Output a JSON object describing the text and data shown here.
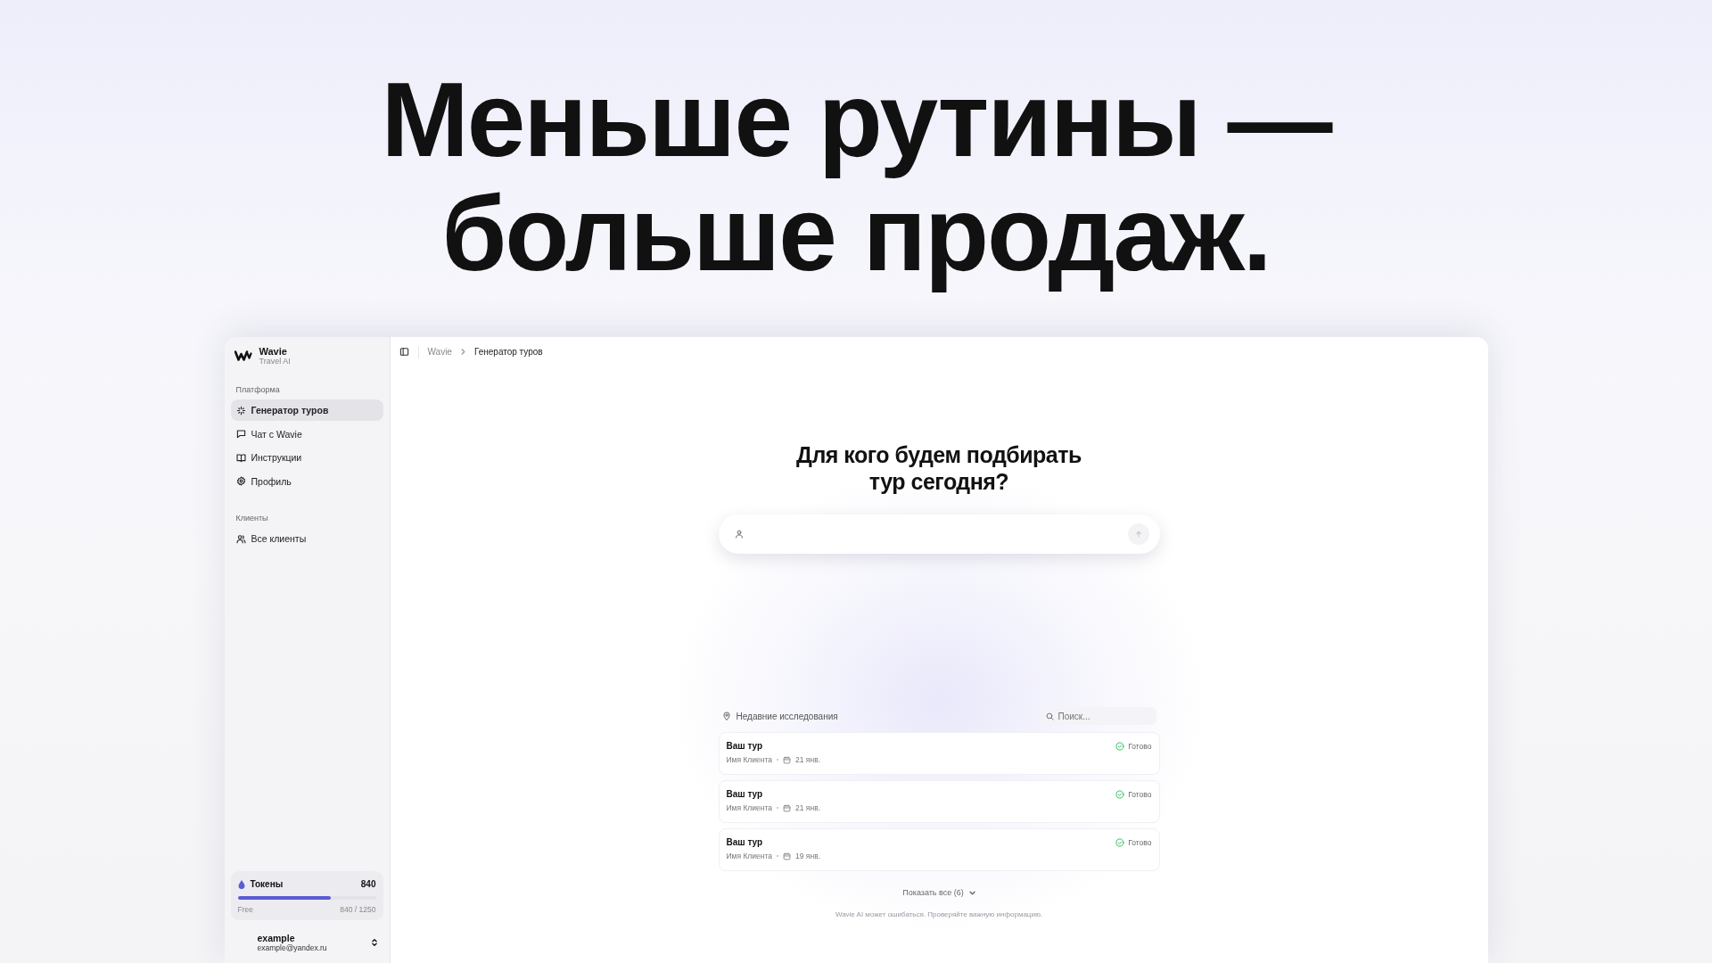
{
  "headline": {
    "lines": [
      "Меньше рутины —",
      "больше продаж."
    ]
  },
  "sidebar": {
    "brand": {
      "name": "Wavie",
      "subtitle": "Travel AI"
    },
    "groups": [
      {
        "label": "Платформа",
        "items": [
          {
            "label": "Генератор туров",
            "selected": true
          },
          {
            "label": "Чат с Wavie",
            "selected": false
          },
          {
            "label": "Инструкции",
            "selected": false
          },
          {
            "label": "Профиль",
            "selected": false
          }
        ]
      },
      {
        "label": "Клиенты",
        "items": [
          {
            "label": "Все клиенты",
            "selected": false
          }
        ]
      }
    ],
    "tokens": {
      "label": "Токены",
      "count": "840",
      "level": 0.672,
      "plan": "Free",
      "usage": "840 / 1250"
    },
    "user": {
      "name": "example",
      "email": "example@yandex.ru"
    }
  },
  "breadcrumb": [
    {
      "label": "Wavie",
      "selected": false
    },
    {
      "label": "Генератор туров",
      "selected": true
    }
  ],
  "main": {
    "heading": "Для кого будем подбирать тур сегодня?",
    "recent": {
      "title": "Недавние исследования",
      "search_placeholder": "Поиск...",
      "items": [
        {
          "title": "Ваш тур",
          "client": "Имя Клиента",
          "date": "21 янв.",
          "status": {
            "kind": "done",
            "label": "Готово"
          }
        },
        {
          "title": "Ваш тур",
          "client": "Имя Клиента",
          "date": "21 янв.",
          "status": {
            "kind": "done",
            "label": "Готово"
          }
        },
        {
          "title": "Ваш тур",
          "client": "Имя Клиента",
          "date": "19 янв.",
          "status": {
            "kind": "done",
            "label": "Готово"
          }
        }
      ],
      "show_all": "Показать все (6)"
    },
    "disclaimer": "Wavie AI может ошибаться. Проверяйте важную информацию."
  }
}
